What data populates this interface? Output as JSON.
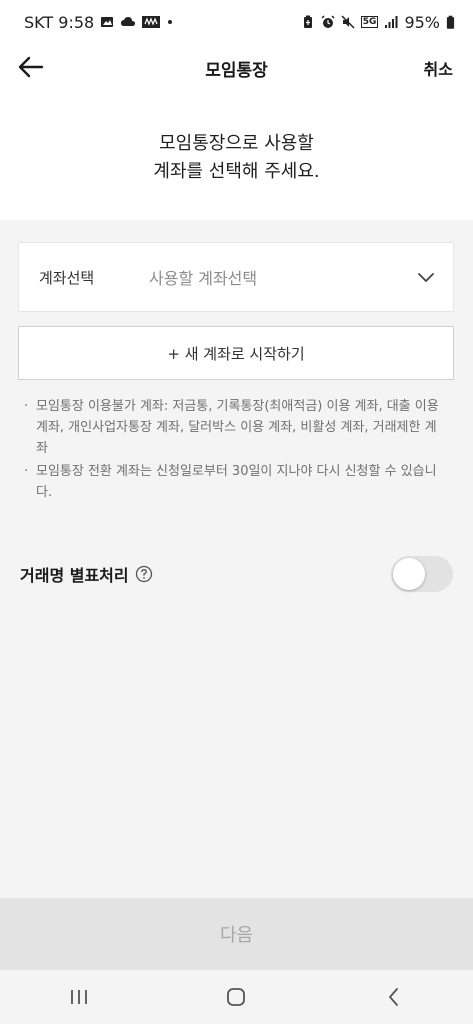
{
  "status_bar": {
    "carrier_time": "SKT 9:58",
    "network": "5G",
    "battery": "95%",
    "left_icons": [
      "gallery-icon",
      "cloud-icon",
      "app-icon",
      "dot-icon"
    ],
    "right_icons": [
      "battery-saver-icon",
      "alarm-icon",
      "mute-icon",
      "network-5g-icon",
      "signal-icon",
      "battery-icon"
    ]
  },
  "header": {
    "title": "모임통장",
    "cancel_label": "취소"
  },
  "intro": {
    "line1": "모임통장으로 사용할",
    "line2": "계좌를 선택해 주세요."
  },
  "account_select": {
    "label": "계좌선택",
    "placeholder": "사용할 계좌선택"
  },
  "new_account_button": {
    "label": "+ 새 계좌로 시작하기"
  },
  "notices": [
    {
      "bullet": "·",
      "text": "모임통장 이용불가 계좌: 저금통, 기록통장(최애적금) 이용 계좌, 대출 이용 계좌, 개인사업자통장 계좌, 달러박스 이용 계좌, 비활성 계좌, 거래제한 계좌"
    },
    {
      "bullet": "·",
      "text": "모임통장 전환 계좌는 신청일로부터 30일이 지나야 다시 신청할 수 있습니다."
    }
  ],
  "toggle_row": {
    "label": "거래명 별표처리",
    "enabled": false
  },
  "next_button": {
    "label": "다음"
  },
  "colors": {
    "background": "#f4f4f4",
    "surface": "#ffffff",
    "disabled_button": "#e3e3e3",
    "disabled_text": "#a8a8a8",
    "muted_text": "#707070"
  }
}
